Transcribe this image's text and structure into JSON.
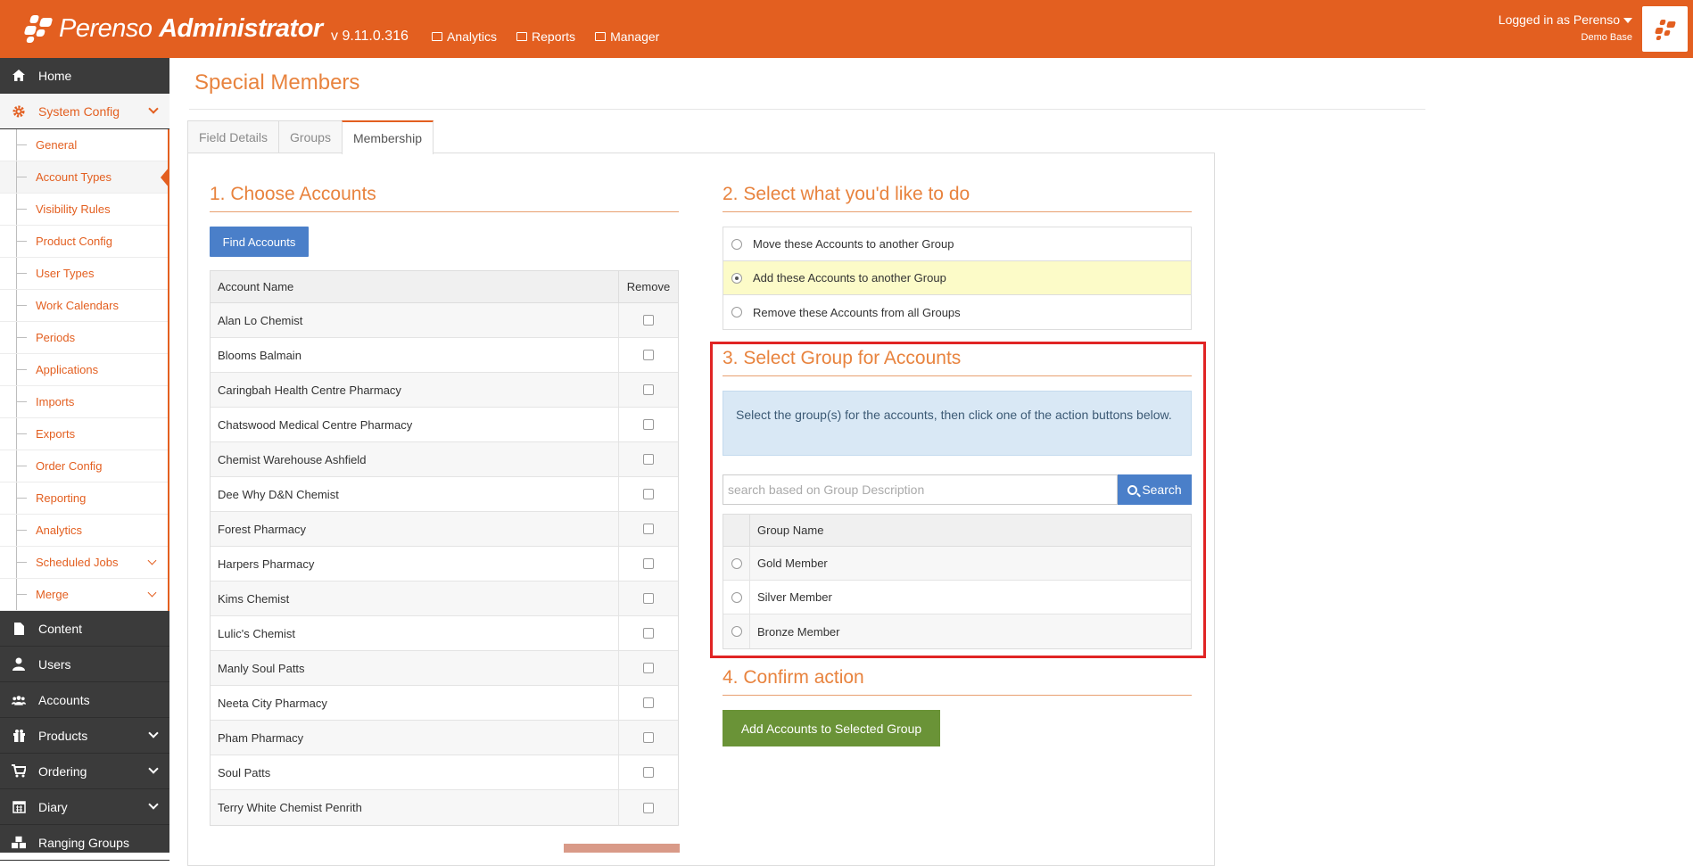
{
  "header": {
    "brand_light": "Perenso",
    "brand_bold": "Administrator",
    "version": "v 9.11.0.316",
    "nav": [
      {
        "label": "Analytics",
        "icon": "chart-icon"
      },
      {
        "label": "Reports",
        "icon": "table-icon"
      },
      {
        "label": "Manager",
        "icon": "briefcase-icon"
      }
    ],
    "user_line": "Logged in as Perenso",
    "user_db": "Demo Base",
    "colors": {
      "brand": "#e35f20",
      "sidebar": "#3b3b3b",
      "accent_title": "#e8833e"
    }
  },
  "sidebar": {
    "top_items": [
      {
        "label": "Home",
        "icon": "home-icon"
      }
    ],
    "active": {
      "label": "System Config",
      "icon": "gear-icon"
    },
    "sub_items": [
      "General",
      "Account Types",
      "Visibility Rules",
      "Product Config",
      "User Types",
      "Work Calendars",
      "Periods",
      "Applications",
      "Imports",
      "Exports",
      "Order Config",
      "Reporting",
      "Analytics",
      "Scheduled Jobs",
      "Merge"
    ],
    "bottom_items": [
      {
        "label": "Content",
        "icon": "file-icon"
      },
      {
        "label": "Users",
        "icon": "user-icon"
      },
      {
        "label": "Accounts",
        "icon": "users-icon"
      },
      {
        "label": "Products",
        "icon": "gift-icon"
      },
      {
        "label": "Ordering",
        "icon": "cart-icon"
      },
      {
        "label": "Diary",
        "icon": "calendar-icon"
      },
      {
        "label": "Ranging Groups",
        "icon": "cubes-icon"
      }
    ]
  },
  "page": {
    "title": "Special Members",
    "tabs": [
      "Field Details",
      "Groups",
      "Membership"
    ],
    "active_tab": "Membership"
  },
  "section1": {
    "title": "1. Choose Accounts",
    "find_button": "Find Accounts",
    "col_name": "Account Name",
    "col_remove": "Remove",
    "accounts": [
      "Alan Lo Chemist",
      "Blooms Balmain",
      "Caringbah Health Centre Pharmacy",
      "Chatswood Medical Centre Pharmacy",
      "Chemist Warehouse Ashfield",
      "Dee Why D&N Chemist",
      "Forest Pharmacy",
      "Harpers Pharmacy",
      "Kims Chemist",
      "Lulic's Chemist",
      "Manly Soul Patts",
      "Neeta City Pharmacy",
      "Pham Pharmacy",
      "Soul Patts",
      "Terry White Chemist Penrith"
    ]
  },
  "section2": {
    "title": "2. Select what you'd like to do",
    "options": [
      "Move these Accounts to another Group",
      "Add these Accounts to another Group",
      "Remove these Accounts from all Groups"
    ],
    "selected": "Add these Accounts to another Group"
  },
  "section3": {
    "title": "3. Select Group for Accounts",
    "info": "Select the group(s) for the accounts, then click one of the action buttons below.",
    "search_placeholder": "search based on Group Description",
    "search_button": "Search",
    "col_group": "Group Name",
    "groups": [
      "Gold Member",
      "Silver Member",
      "Bronze Member"
    ]
  },
  "section4": {
    "title": "4. Confirm action",
    "confirm_button": "Add Accounts to Selected Group"
  }
}
